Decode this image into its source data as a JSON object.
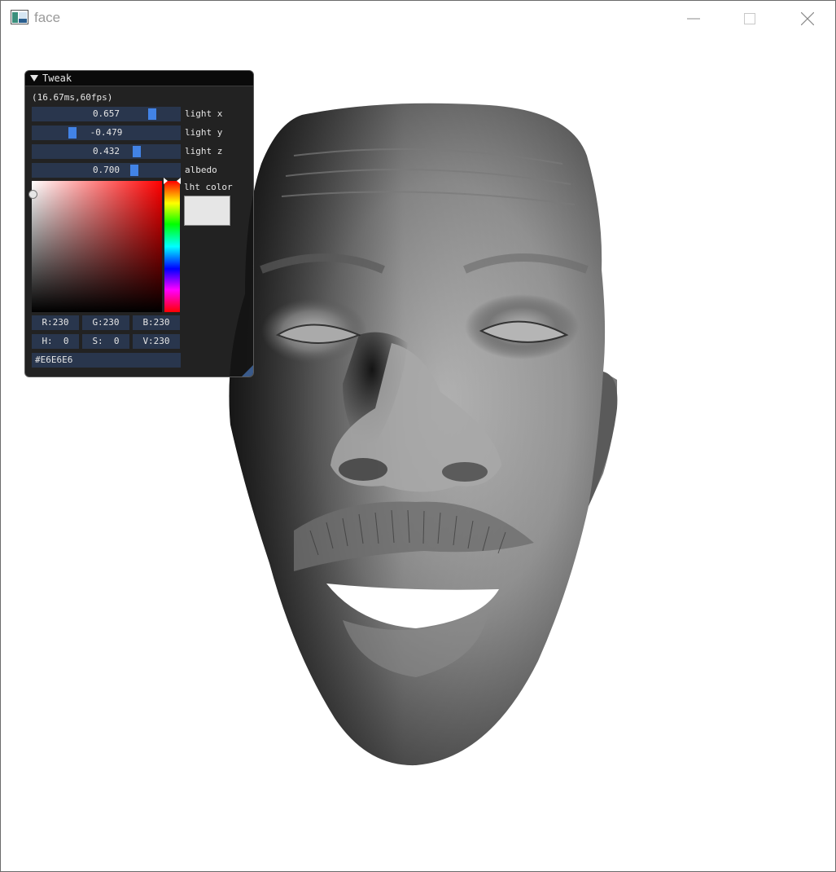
{
  "window": {
    "title": "face",
    "icon": "app-window-icon",
    "controls": [
      "minimize-icon",
      "maximize-icon",
      "close-icon"
    ]
  },
  "tweak_panel": {
    "title": "Tweak",
    "fps_text": "(16.67ms,60fps)",
    "sliders": [
      {
        "label": "light x",
        "value": "0.657",
        "level": 0.8285
      },
      {
        "label": "light y",
        "value": "-0.479",
        "level": 0.2605
      },
      {
        "label": "light z",
        "value": "0.432",
        "level": 0.716
      },
      {
        "label": "albedo",
        "value": "0.700",
        "level": 0.7
      }
    ],
    "color_label": "lht color",
    "color": {
      "hex": "#E6E6E6",
      "r": "R:230",
      "g": "G:230",
      "b": "B:230",
      "h": "H:  0",
      "s": "S:  0",
      "v": "V:230"
    }
  },
  "viewport": {
    "content": "3d-face-render",
    "background": "#ffffff"
  }
}
